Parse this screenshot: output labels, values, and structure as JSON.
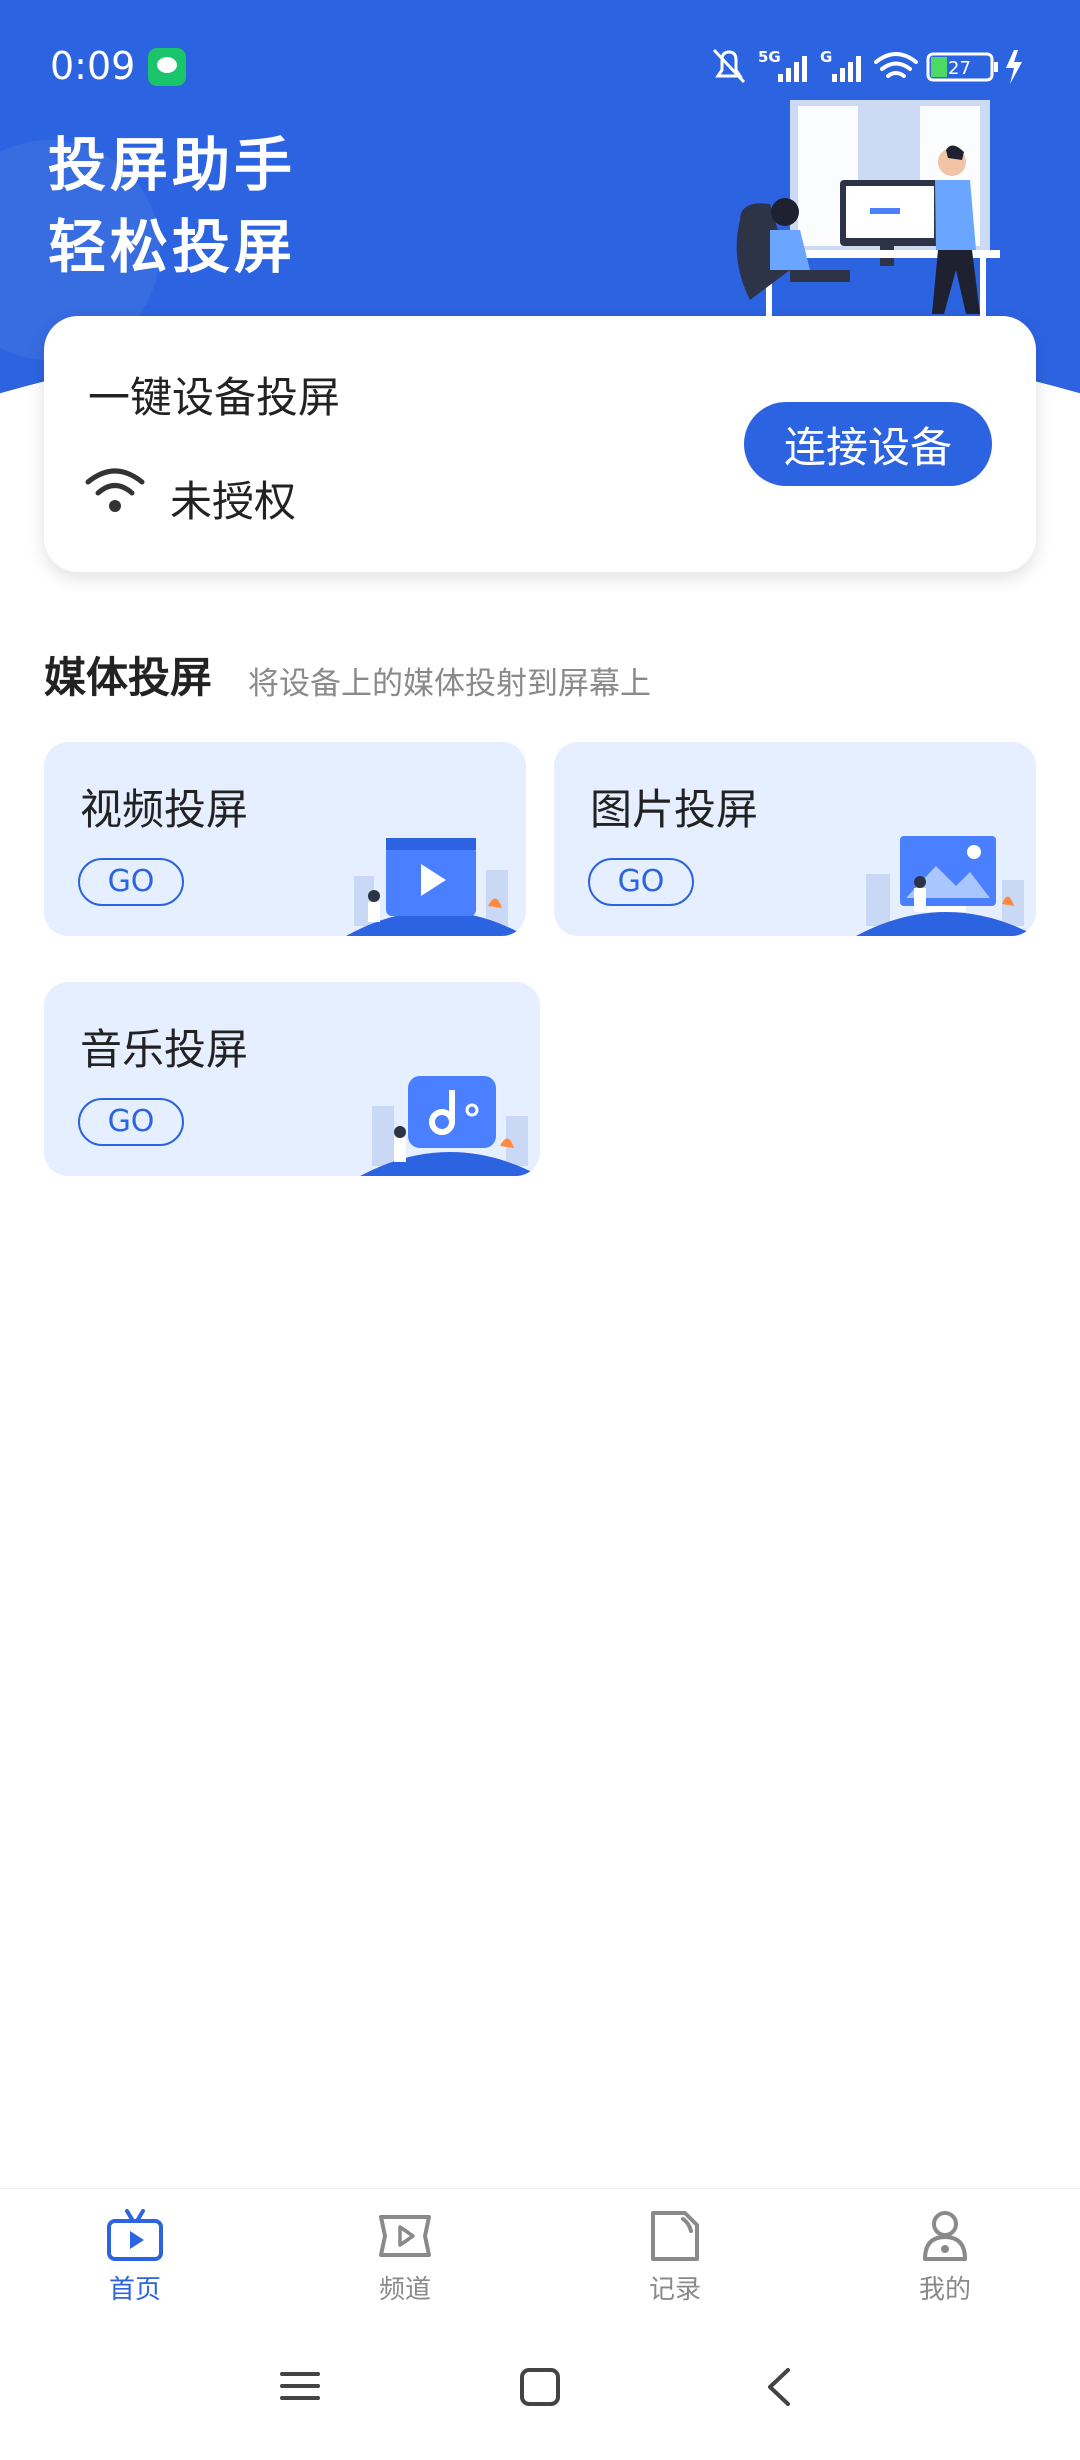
{
  "status_bar": {
    "time": "0:09",
    "signal_label_1": "5G",
    "signal_label_2": "G",
    "battery": "27"
  },
  "hero": {
    "title_line1": "投屏助手",
    "title_line2": "轻松投屏"
  },
  "connect_card": {
    "title": "一键设备投屏",
    "status": "未授权",
    "button_label": "连接设备"
  },
  "media_section": {
    "title": "媒体投屏",
    "subtitle": "将设备上的媒体投射到屏幕上",
    "cards": [
      {
        "label": "视频投屏",
        "go": "GO"
      },
      {
        "label": "图片投屏",
        "go": "GO"
      },
      {
        "label": "音乐投屏",
        "go": "GO"
      }
    ]
  },
  "bottom_nav": {
    "items": [
      {
        "label": "首页",
        "icon": "tv-icon",
        "active": true
      },
      {
        "label": "频道",
        "icon": "video-play-icon",
        "active": false
      },
      {
        "label": "记录",
        "icon": "record-doc-icon",
        "active": false
      },
      {
        "label": "我的",
        "icon": "user-icon",
        "active": false
      }
    ]
  },
  "colors": {
    "accent": "#2c63e0",
    "card_bg": "#e6efff",
    "inactive": "#8a8a8a"
  }
}
